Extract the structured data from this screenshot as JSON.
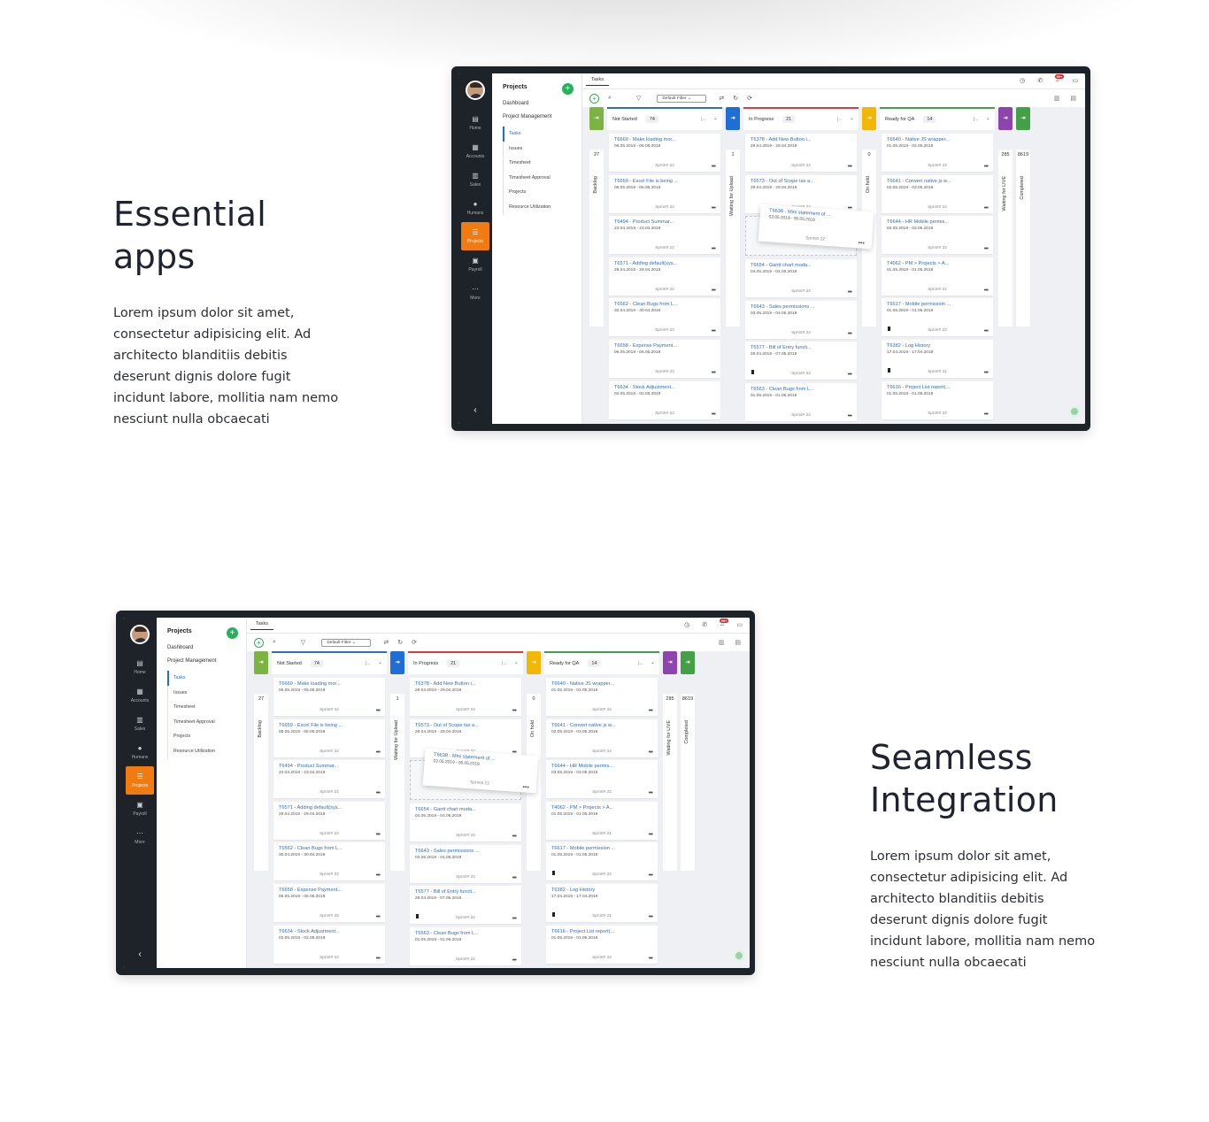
{
  "sections": [
    {
      "title": "Essential apps",
      "body": "Lorem ipsum dolor sit amet, consectetur adipisicing elit. Ad architecto blanditiis debitis deserunt dignis dolore fugit incidunt labore, mollitia nam nemo nesciunt nulla obcaecati"
    },
    {
      "title": "Seamless Integration",
      "body": "Lorem ipsum dolor sit amet, consectetur adipisicing elit. Ad architecto blanditiis debitis deserunt dignis dolore fugit incidunt labore, mollitia nam nemo nesciunt nulla obcaecati"
    }
  ],
  "app": {
    "rail": [
      {
        "icon": "home-icon",
        "glyph": "▤",
        "label": "Home"
      },
      {
        "icon": "grid-icon",
        "glyph": "▦",
        "label": "Accounts"
      },
      {
        "icon": "bar-chart-icon",
        "glyph": "▥",
        "label": "Sales"
      },
      {
        "icon": "person-icon",
        "glyph": "●",
        "label": "Humans"
      },
      {
        "icon": "list-icon",
        "glyph": "☰",
        "label": "Projects",
        "active": true
      },
      {
        "icon": "wallet-icon",
        "glyph": "▣",
        "label": "Payroll"
      },
      {
        "icon": "dots-icon",
        "glyph": "⋯",
        "label": "More"
      }
    ],
    "collapse_glyph": "‹",
    "nav": {
      "title": "Projects",
      "add": "+",
      "links": [
        "Dashboard",
        "Project Management"
      ],
      "sub": [
        "Tasks",
        "Issues",
        "Timesheet",
        "Timesheet Approval",
        "Projects",
        "Resource Utilization"
      ]
    },
    "tab": "Tasks",
    "notif_count": "99+",
    "filter": "Default Filter",
    "dots": "•••",
    "columns": [
      {
        "name": "Not Started",
        "count": "74",
        "color": "#2f6ebd",
        "collapsed_before": {
          "count": "27",
          "label": "Backlog",
          "color": "#7cb342"
        },
        "cards": [
          {
            "title": "T6660 - Make loading mor...",
            "dates": "06.05.2019 - 06.05.2019",
            "sprint": "Sprint# 22"
          },
          {
            "title": "T6659 - Excel File is being ...",
            "dates": "06.05.2019 - 06.05.2019",
            "sprint": "Sprint# 22"
          },
          {
            "title": "T6494 - Product Summar...",
            "dates": "23.04.2019 - 23.04.2019",
            "sprint": "Sprint# 21"
          },
          {
            "title": "T6571 - Adding default(sys...",
            "dates": "29.04.2019 - 29.04.2019",
            "sprint": "Sprint# 22"
          },
          {
            "title": "T6562 - Clean Bugs from L...",
            "dates": "30.04.2019 - 30.04.2019",
            "sprint": "Sprint# 22"
          },
          {
            "title": "T6658 - Expense Payment...",
            "dates": "06.05.2019 - 06.05.2019",
            "sprint": "Sprint# 22"
          },
          {
            "title": "T6634 - Stock Adjustment...",
            "dates": "02.05.2019 - 02.05.2019",
            "sprint": "Sprint# 22"
          }
        ]
      },
      {
        "name": "In Progress",
        "count": "21",
        "color": "#e03b3b",
        "collapsed_before": {
          "count": "1",
          "label": "Waiting for Upload",
          "color": "#1e6ed6"
        },
        "drag": {
          "title": "T6638 - Mini statement of ...",
          "dates": "02.05.2019 - 06.05.2019",
          "sprint": "Sprint# 22"
        },
        "cards": [
          {
            "title": "T6378 - Add New Button i...",
            "dates": "29.04.2019 - 29.04.2019",
            "sprint": "Sprint# 22"
          },
          {
            "title": "T6573 - Out of Scope tax a...",
            "dates": "29.04.2019 - 29.04.2019",
            "sprint": "Sprint# 22"
          },
          {
            "title": "T6654 - Gantt chart moda...",
            "dates": "04.05.2019 - 04.05.2019",
            "sprint": "Sprint# 22"
          },
          {
            "title": "T6643 - Sales permissions ...",
            "dates": "03.05.2019 - 04.05.2019",
            "sprint": "Sprint# 22"
          },
          {
            "title": "T6577 - Bill of Entry functi...",
            "dates": "29.04.2019 - 07.05.2019",
            "sprint": "Sprint# 22",
            "flag": true
          },
          {
            "title": "T6563 - Clean Bugs from L...",
            "dates": "01.05.2019 - 01.05.2019",
            "sprint": "Sprint# 22"
          }
        ]
      },
      {
        "name": "Ready for QA",
        "count": "14",
        "color": "#43a047",
        "collapsed_before": {
          "count": "0",
          "label": "On hold",
          "color": "#f2b705"
        },
        "cards": [
          {
            "title": "T6640 - Native JS wrapper...",
            "dates": "01.05.2019 - 02.05.2019",
            "sprint": "Sprint# 22"
          },
          {
            "title": "T6641 - Convert native js w...",
            "dates": "02.05.2019 - 03.05.2019",
            "sprint": "Sprint# 22"
          },
          {
            "title": "T6644 - HR Mobile permis...",
            "dates": "03.05.2019 - 03.05.2019",
            "sprint": "Sprint# 22"
          },
          {
            "title": "T4062 - PM > Projects > A...",
            "dates": "01.05.2019 - 01.05.2019",
            "sprint": "Sprint# 21"
          },
          {
            "title": "T6617 - Mobile permission ...",
            "dates": "01.05.2019 - 01.05.2019",
            "sprint": "Sprint# 22",
            "flag": true
          },
          {
            "title": "T6382 - Log History",
            "dates": "17.04.2019 - 17.04.2019",
            "sprint": "Sprint# 21",
            "flag": true
          },
          {
            "title": "T6616 - Project List report(...",
            "dates": "01.05.2019 - 01.05.2019",
            "sprint": "Sprint# 22"
          }
        ]
      }
    ],
    "collapsed_after": [
      {
        "count": "285",
        "label": "Waiting for LIVE",
        "color": "#8e44ad"
      },
      {
        "count": "8619",
        "label": "Completed",
        "color": "#43a047"
      }
    ]
  }
}
